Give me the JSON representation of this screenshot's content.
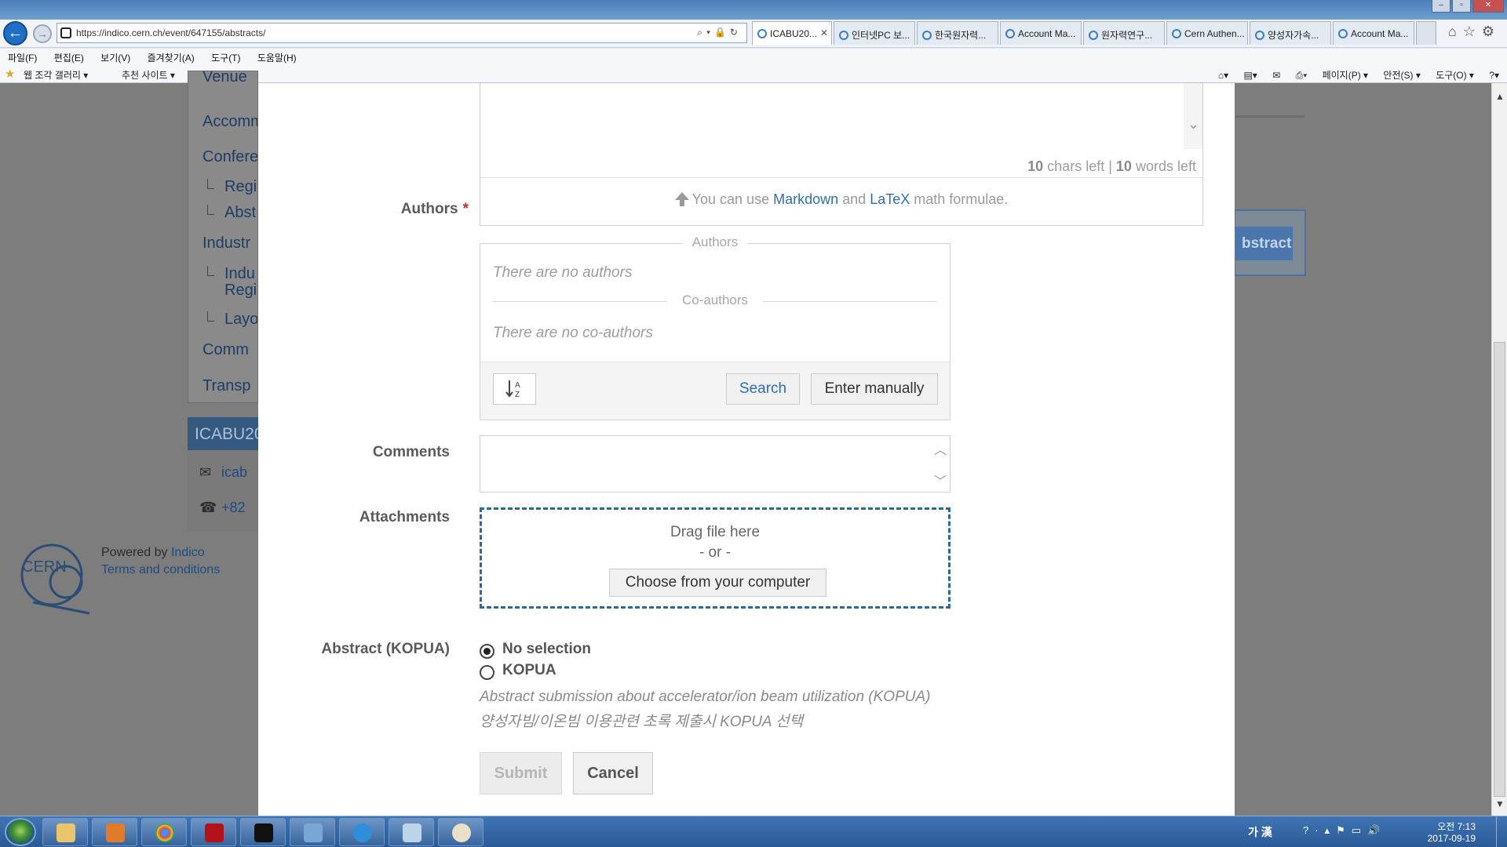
{
  "browser": {
    "url": "https://indico.cern.ch/event/647155/abstracts/",
    "tabs": [
      {
        "label": "ICABU20...",
        "active": true
      },
      {
        "label": "인터넷PC 보...",
        "active": false
      },
      {
        "label": "한국원자력...",
        "active": false
      },
      {
        "label": "Account Ma...",
        "active": false
      },
      {
        "label": "원자력연구...",
        "active": false
      },
      {
        "label": "Cern Authen...",
        "active": false
      },
      {
        "label": "양성자가속...",
        "active": false
      },
      {
        "label": "Account Ma...",
        "active": false
      }
    ],
    "menu": [
      "파일(F)",
      "편집(E)",
      "보기(V)",
      "즐겨찾기(A)",
      "도구(T)",
      "도움말(H)"
    ],
    "favorites": [
      "웹 조각 갤러리 ▾",
      "추천 사이트 ▾"
    ],
    "commandbar": [
      "페이지(P) ▾",
      "안전(S) ▾",
      "도구(O) ▾"
    ]
  },
  "background_page": {
    "sidebar_items": [
      "Venue",
      "Accomm",
      "Confere",
      "Industr",
      "Comm",
      "Transp"
    ],
    "sidebar_subitems": [
      "Regi",
      "Abst",
      "Indu Regi",
      "Layo"
    ],
    "contact": {
      "header": "ICABU20",
      "email": "icab",
      "phone": "+82"
    },
    "powered_by": "Powered by",
    "indico_link": "Indico",
    "terms": "Terms and conditions",
    "cern_logo": "CERN",
    "right_button": "bstract"
  },
  "form": {
    "content": {
      "chars_left": "10",
      "chars_label": "chars left",
      "separator": "|",
      "words_left": "10",
      "words_label": "words left",
      "hint_prefix": "You can use",
      "hint_markdown": "Markdown",
      "hint_and": "and",
      "hint_latex": "LaTeX",
      "hint_suffix": "math formulae."
    },
    "authors": {
      "label": "Authors",
      "required_mark": "*",
      "authors_header": "Authors",
      "no_authors": "There are no authors",
      "coauthors_header": "Co-authors",
      "no_coauthors": "There are no co-authors",
      "search_button": "Search",
      "manual_button": "Enter manually"
    },
    "comments": {
      "label": "Comments",
      "value": ""
    },
    "attachments": {
      "label": "Attachments",
      "drag_text": "Drag file here",
      "or_text": "- or -",
      "choose_button": "Choose from your computer"
    },
    "kopua": {
      "label": "Abstract (KOPUA)",
      "options": [
        {
          "label": "No selection",
          "checked": true
        },
        {
          "label": "KOPUA",
          "checked": false
        }
      ],
      "help_en": "Abstract submission about accelerator/ion beam utilization (KOPUA)",
      "help_ko": "양성자빔/이온빔 이용관련 초록 제출시 KOPUA 선택"
    },
    "submit_button": "Submit",
    "cancel_button": "Cancel"
  },
  "taskbar": {
    "ime": "가 漢",
    "time": "오전 7:13",
    "date": "2017-09-19"
  },
  "colors": {
    "accent": "#2e6fb3",
    "required": "#c62828",
    "dropzone_border": "#2b6a98"
  }
}
